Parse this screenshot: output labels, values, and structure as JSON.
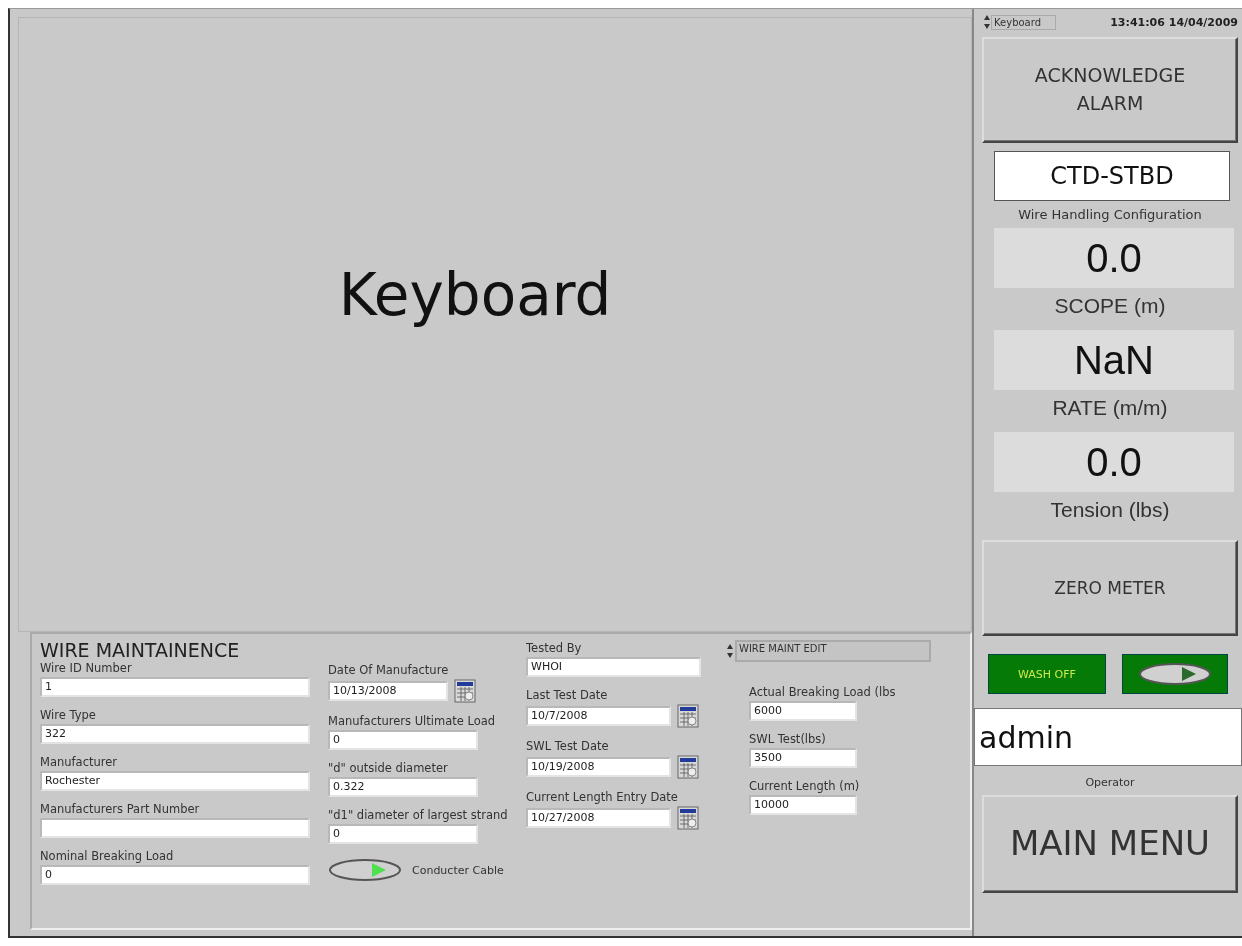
{
  "display": {
    "title": "Keyboard"
  },
  "maintenance": {
    "title": "WIRE MAINTAINENCE",
    "mode": "WIRE MAINT EDIT",
    "columns": [
      [
        {
          "label": "Wire ID Number",
          "value": "1",
          "kind": "text"
        },
        {
          "label": "Wire Type",
          "value": "322",
          "kind": "text"
        },
        {
          "label": "Manufacturer",
          "value": "Rochester",
          "kind": "text"
        },
        {
          "label": "Manufacturers Part Number",
          "kind": "text"
        },
        {
          "label": "Nominal Breaking Load",
          "value": "0",
          "kind": "text"
        }
      ],
      [
        {
          "label": "Date Of Manufacture",
          "value": "10/13/2008",
          "kind": "date"
        },
        {
          "label": "Manufacturers Ultimate Load",
          "value": "0",
          "kind": "text"
        },
        {
          "label": "\"d\" outside diameter",
          "value": "0.322",
          "kind": "text"
        },
        {
          "label": "\"d1\" diameter of largest strand",
          "value": "0",
          "kind": "text"
        }
      ],
      [
        {
          "label": "Tested By",
          "value": "WHOI",
          "kind": "text"
        },
        {
          "label": "Last Test Date",
          "value": "10/7/2008",
          "kind": "date"
        },
        {
          "label": "SWL Test Date",
          "value": "10/19/2008",
          "kind": "date"
        },
        {
          "label": "Current Length Entry Date",
          "value": "10/27/2008",
          "kind": "date"
        }
      ],
      [
        {
          "label": "Actual Breaking Load (lbs",
          "value": "6000",
          "kind": "text"
        },
        {
          "label": "SWL Test(lbs)",
          "value": "3500",
          "kind": "text"
        },
        {
          "label": "Current Length (m)",
          "value": "10000",
          "kind": "text"
        }
      ]
    ],
    "toggle": {
      "label": "Conducter Cable",
      "on": true
    }
  },
  "sidebar": {
    "view_selector": "Keyboard",
    "clock": "13:41:06 14/04/2009",
    "acknowledge_button": "ACKNOWLEDGE ALARM",
    "configuration": {
      "value": "CTD-STBD",
      "label": "Wire Handling Configuration"
    },
    "readouts": [
      {
        "value": "0.0",
        "label": "SCOPE (m)"
      },
      {
        "value": "NaN",
        "label": "RATE (m/m)"
      },
      {
        "value": "0.0",
        "label": "Tension (lbs)"
      }
    ],
    "zero_button": "ZERO METER",
    "wash": {
      "label": "WASH OFF",
      "on": false
    },
    "operator": {
      "value": "admin",
      "label": "Operator"
    },
    "main_menu_button": "MAIN MENU"
  }
}
